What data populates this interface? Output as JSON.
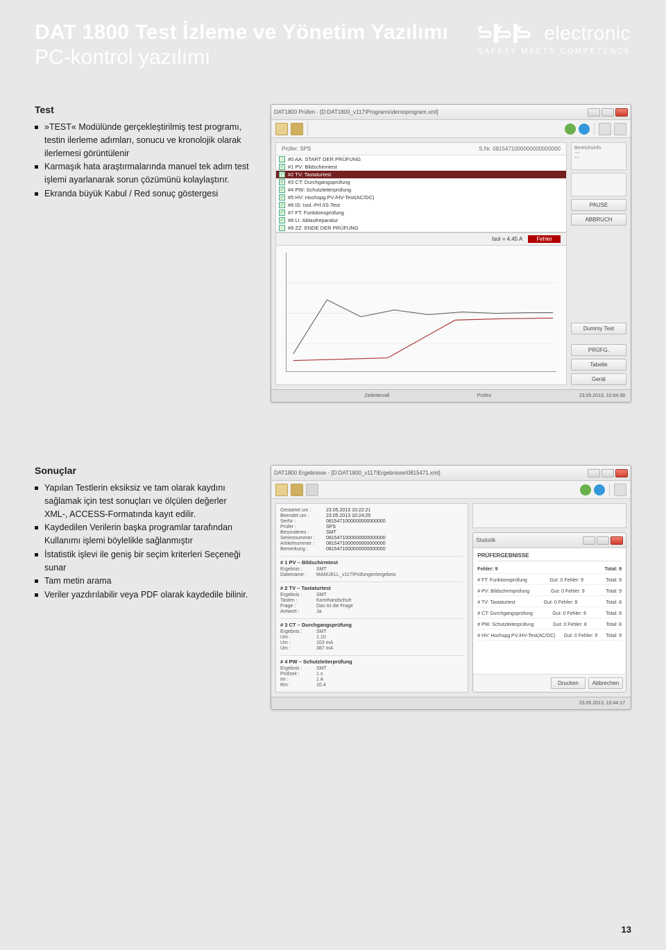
{
  "page_number": "13",
  "header": {
    "title": "DAT 1800 Test İzleme ve Yönetim Yazılımı",
    "subtitle": "PC-kontrol yazılımı",
    "logo_text": "electronic",
    "logo_tagline": "SAFETY MEETS COMPETENCE"
  },
  "section1": {
    "heading": "Test",
    "bullets": [
      "»TEST« Modülünde gerçekleştirilmiş test programı, testin ilerleme adımları, sonucu ve kronolojik olarak ilerlemesi görüntülenir",
      "Karmaşık hata araştırmalarında manuel tek adım test işlemi ayarlanarak sorun çözümünü kolaylaştırır.",
      "Ekranda büyük Kabul / Red sonuç göstergesi"
    ]
  },
  "section2": {
    "heading": "Sonuçlar",
    "bullets": [
      "Yapılan Testlerin eksiksiz ve tam olarak kaydını sağlamak için test sonuçları ve ölçülen değerler XML-, ACCESS-Formatında kayıt edilir.",
      "Kaydedilen Verilerin başka programlar tarafından Kullanımı işlemi böylelikle sağlanmıştır",
      "İstatistik işlevi ile geniş bir seçim kriterleri Seçeneği sunar",
      "Tam metin arama",
      "Veriler yazdırılabilir veya PDF olarak kaydedile bilinir."
    ]
  },
  "screenshot1": {
    "title": "DAT1800  Prüfen - [D:DAT1800_v117\\Programs\\demoprogram.xml]",
    "header_left": "Prüfer: SPS",
    "header_right": "S.Nr. 0815471000000000000000",
    "steps": [
      "#0 AA: START DER PRÜFUNG",
      "#1 PV: Bildschirmtest",
      "#2 TV: Tastaturtest",
      "#3 CT: Durchgangsprüfung",
      "#4 PW: Schutzleiterprüfung",
      "#5 HV: Hochspg.PV./HV-Test(AC/DC)",
      "#6 IS: Isol.-Prf./IS-Test",
      "#7 FT: Funktionsprüfung",
      "#8 LI: Ablaufreparatur",
      "#9 ZZ: ENDE DER PRÜFUNG"
    ],
    "result_label": "Isol = 4.45  A",
    "result_tag": "Fehler",
    "side_buttons_top": [
      "PAUSE",
      "ABBRUCH"
    ],
    "side_buttons_bottom": [
      "Dummy Test",
      "PRÜFG.",
      "Tabelle",
      "Gerät"
    ],
    "status_left": "",
    "status_mid1": "Zeitintervall",
    "status_mid2": "Prüfen",
    "status_right": "23.05.2013, 10:04:38"
  },
  "screenshot2": {
    "title": "DAT1800  Ergebnisse - [D:DAT1800_v117\\Ergebnisse\\0815471.xml]",
    "meta": {
      "Gestartet um :": "23.05.2013 10:22:21",
      "Beendet um :": "23.05.2013 10:24:25",
      "SerNr :": "0815471000000000000000",
      "Prüfer :": "SPS",
      "Besonderes :": "SMT",
      "Seriennummer :": "0815471000000000000000",
      "Artikelnummer :": "0815471000000000000000",
      "Bemerkung :": "0815471000000000000000"
    },
    "groups": [
      {
        "t": "# 1 PV – Bildschirmtest",
        "rows": {
          "Ergebnis :": "SMT",
          "Dateiname :": "MANUELL_v117\\Prüfungen\\ergebnis"
        }
      },
      {
        "t": "# 2 TV – Tastaturtest",
        "rows": {
          "Ergebnis :": "SMT",
          "Tasten :": "Komthandschuh",
          "Frage :": "Das ist die Frage",
          "Antwort :": "Ja"
        }
      },
      {
        "t": "# 3 CT – Durchgangsprüfung",
        "rows": {
          "Ergebnis :": "SMT",
          "Um :": "387 mA"
        }
      },
      {
        "t": "# 4 PW – Schutzleiterprüfung",
        "rows": {
          "Ergebnis :": "SMT",
          "Prüfzeit :": "1 s",
          "Im :": "1 A",
          "Rm :": "10.4"
        }
      }
    ],
    "inner_title": "Statistik",
    "inner_header": "PRÜFERGEBNISSE",
    "inner_summary": {
      "Gut: 0": "Fehler: 9",
      "right": "Total: 9"
    },
    "inner_rows": [
      {
        "l": "# FT: Funktionsprüfung",
        "m": "Gut: 0    Fehler: 9",
        "r": "Total: 9"
      },
      {
        "l": "# PV: Bildschirmprüfung",
        "m": "Gut: 0    Fehler: 9",
        "r": "Total: 9"
      },
      {
        "l": "# TV: Tastaturtest",
        "m": "Gut: 0    Fehler: 8",
        "r": "Total: 8"
      },
      {
        "l": "# CT: Durchgangsprüfung",
        "m": "Gut: 0    Fehler: 8",
        "r": "Total: 8"
      },
      {
        "l": "# PW: Schutzleiterprüfung",
        "m": "Gut: 0    Fehler: 8",
        "r": "Total: 8"
      },
      {
        "l": "# HV: Hochspg.PV./HV-Test(AC/DC)",
        "m": "Gut: 0    Fehler: 9",
        "r": "Total: 9"
      }
    ],
    "inner_buttons": [
      "Drucken",
      "Abbrechen"
    ],
    "status_right": "23.05.2013, 10:44:17"
  }
}
